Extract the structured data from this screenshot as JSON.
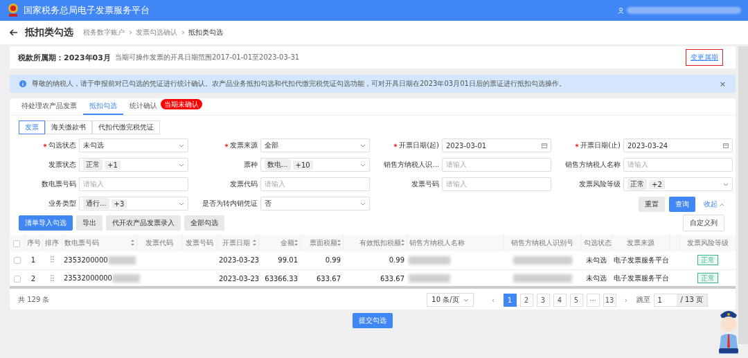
{
  "header": {
    "title": "国家税务总局电子发票服务平台"
  },
  "page": {
    "title": "抵扣类勾选",
    "breadcrumb": [
      {
        "label": "税务数字账户",
        "current": false
      },
      {
        "label": "发票勾选确认",
        "current": false
      },
      {
        "label": "抵扣类勾选",
        "current": true
      }
    ]
  },
  "period": {
    "label": "税款所属期：2023年03月",
    "note": "当期可操作发票的开具日期范围2017-01-01至2023-03-31",
    "change_link": "变更属期"
  },
  "alert": {
    "text": "尊敬的纳税人，请于申报前对已勾选的凭证进行统计确认。农产品业务抵扣勾选和代扣代缴完税凭证勾选功能，可对开具日期在2023年03月01日后的票证进行抵扣勾选操作。",
    "close": "×"
  },
  "tabs": [
    {
      "label": "待处理农产品发票",
      "selected": false
    },
    {
      "label": "抵扣勾选",
      "selected": true
    },
    {
      "label": "统计确认",
      "selected": false,
      "badge": "当期未确认"
    }
  ],
  "subtabs": [
    {
      "label": "发票",
      "selected": true
    },
    {
      "label": "海关缴款书",
      "selected": false
    },
    {
      "label": "代扣代缴完税凭证",
      "selected": false
    }
  ],
  "filters": [
    {
      "label": "勾选状态",
      "required": true,
      "kind": "select",
      "value": "未勾选"
    },
    {
      "label": "发票来源",
      "required": true,
      "kind": "select",
      "value": "全部"
    },
    {
      "label": "开票日期(起)",
      "required": true,
      "kind": "date",
      "value": "2023-03-01"
    },
    {
      "label": "开票日期(止)",
      "required": true,
      "kind": "date",
      "value": "2023-03-24"
    },
    {
      "label": "发票状态",
      "required": false,
      "kind": "tags",
      "tags": [
        "正常",
        "+1"
      ]
    },
    {
      "label": "票种",
      "required": false,
      "kind": "tags",
      "tags": [
        "数电...",
        "+10"
      ]
    },
    {
      "label": "销售方纳税人识...",
      "required": false,
      "kind": "input",
      "placeholder": "请输入"
    },
    {
      "label": "销售方纳税人名称",
      "required": false,
      "kind": "input",
      "placeholder": "请输入"
    },
    {
      "label": "数电票号码",
      "required": false,
      "kind": "input",
      "placeholder": "请输入"
    },
    {
      "label": "发票代码",
      "required": false,
      "kind": "input",
      "placeholder": "请输入"
    },
    {
      "label": "发票号码",
      "required": false,
      "kind": "input",
      "placeholder": "请输入"
    },
    {
      "label": "发票风险等级",
      "required": false,
      "kind": "tags",
      "tags": [
        "正常",
        "+2"
      ]
    },
    {
      "label": "业务类型",
      "required": false,
      "kind": "tags",
      "tags": [
        "通行...",
        "+3"
      ]
    },
    {
      "label": "是否为转内销凭证",
      "required": false,
      "kind": "select",
      "value": "否"
    }
  ],
  "filter_actions": {
    "reset": "重置",
    "query": "查询",
    "collapse": "收起"
  },
  "toolbar": [
    {
      "label": "清单导入勾选",
      "primary": true
    },
    {
      "label": "导出",
      "primary": false
    },
    {
      "label": "代开农产品发票录入",
      "primary": false
    },
    {
      "label": "全部勾选",
      "primary": false
    }
  ],
  "custom_columns": "自定义列",
  "table": {
    "select_all_checked": false,
    "columns": [
      {
        "label": "序号",
        "sortable": false
      },
      {
        "label": "排序",
        "sortable": false
      },
      {
        "label": "数电票号码",
        "sortable": true
      },
      {
        "label": "发票代码",
        "sortable": false
      },
      {
        "label": "发票号码",
        "sortable": false
      },
      {
        "label": "开票日期",
        "sortable": true
      },
      {
        "label": "金额",
        "sortable": true
      },
      {
        "label": "票面税额",
        "sortable": true
      },
      {
        "label": "有效抵扣税额",
        "sortable": true
      },
      {
        "label": "销售方纳税人名称",
        "sortable": false
      },
      {
        "label": "销售方纳税人识别号",
        "sortable": false
      },
      {
        "label": "勾选状态",
        "sortable": false
      },
      {
        "label": "发票来源",
        "sortable": false
      },
      {
        "label": "发票风险等级",
        "sortable": false
      }
    ],
    "rows": [
      {
        "checked": false,
        "index": "1",
        "invoice_no": "2353200000",
        "date": "2023-03-23",
        "amount": "99.01",
        "tax": "0.99",
        "deductible": "0.99",
        "status": "未勾选",
        "source": "电子发票服务平台",
        "risk": "正常"
      },
      {
        "checked": false,
        "index": "2",
        "invoice_no": "23532000000",
        "date": "2023-03-23",
        "amount": "63366.33",
        "tax": "633.67",
        "deductible": "633.67",
        "status": "未勾选",
        "source": "电子发票服务平台",
        "risk": "正常"
      }
    ]
  },
  "pagination": {
    "total": "共 129 条",
    "page_size": "10 条/页",
    "pages": [
      {
        "label": "1",
        "selected": true
      },
      {
        "label": "2",
        "selected": false
      },
      {
        "label": "3",
        "selected": false
      },
      {
        "label": "4",
        "selected": false
      },
      {
        "label": "5",
        "selected": false
      },
      {
        "label": "···",
        "selected": false
      },
      {
        "label": "13",
        "selected": false
      }
    ],
    "prev": "‹",
    "next": "›",
    "jump_label": "跳至",
    "jump_value": "1",
    "page_count": "/ 13 页"
  },
  "submit": "提交勾选"
}
